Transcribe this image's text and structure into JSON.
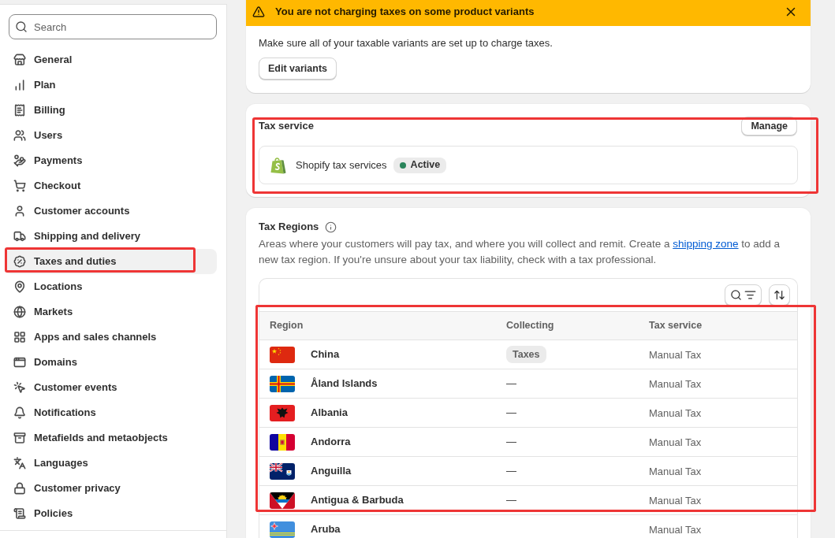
{
  "sidebar": {
    "search": {
      "placeholder": "Search"
    },
    "items": [
      {
        "label": "General",
        "selected": false,
        "highlighted": false
      },
      {
        "label": "Plan",
        "selected": false,
        "highlighted": false
      },
      {
        "label": "Billing",
        "selected": false,
        "highlighted": false
      },
      {
        "label": "Users",
        "selected": false,
        "highlighted": false
      },
      {
        "label": "Payments",
        "selected": false,
        "highlighted": false
      },
      {
        "label": "Checkout",
        "selected": false,
        "highlighted": false
      },
      {
        "label": "Customer accounts",
        "selected": false,
        "highlighted": false
      },
      {
        "label": "Shipping and delivery",
        "selected": false,
        "highlighted": false
      },
      {
        "label": "Taxes and duties",
        "selected": true,
        "highlighted": true
      },
      {
        "label": "Locations",
        "selected": false,
        "highlighted": false
      },
      {
        "label": "Markets",
        "selected": false,
        "highlighted": false
      },
      {
        "label": "Apps and sales channels",
        "selected": false,
        "highlighted": false
      },
      {
        "label": "Domains",
        "selected": false,
        "highlighted": false
      },
      {
        "label": "Customer events",
        "selected": false,
        "highlighted": false
      },
      {
        "label": "Notifications",
        "selected": false,
        "highlighted": false
      },
      {
        "label": "Metafields and metaobjects",
        "selected": false,
        "highlighted": false
      },
      {
        "label": "Languages",
        "selected": false,
        "highlighted": false
      },
      {
        "label": "Customer privacy",
        "selected": false,
        "highlighted": false
      },
      {
        "label": "Policies",
        "selected": false,
        "highlighted": false
      }
    ]
  },
  "banner": {
    "title": "You are not charging taxes on some product variants",
    "message": "Make sure all of your taxable variants are set up to charge taxes.",
    "button": "Edit variants"
  },
  "tax_service": {
    "title": "Tax service",
    "button": "Manage",
    "highlighted": true,
    "service": {
      "name": "Shopify tax services",
      "status": "Active"
    }
  },
  "tax_regions": {
    "title": "Tax Regions",
    "description_before": "Areas where your customers will pay tax, and where you will collect and remit. Create a ",
    "link": "shipping zone",
    "description_after": " to add a new tax region. If you're unsure about your tax liability, check with a tax professional.",
    "table": {
      "columns": [
        "Region",
        "Collecting",
        "Tax service"
      ],
      "header_highlighted": true,
      "rows": [
        {
          "region": "China",
          "collecting": {
            "kind": "tag",
            "text": "Taxes"
          },
          "tax_service": "Manual Tax",
          "highlighted": true
        },
        {
          "region": "Åland Islands",
          "collecting": {
            "kind": "plain",
            "text": "—"
          },
          "tax_service": "Manual Tax",
          "highlighted": true
        },
        {
          "region": "Albania",
          "collecting": {
            "kind": "plain",
            "text": "—"
          },
          "tax_service": "Manual Tax",
          "highlighted": true
        },
        {
          "region": "Andorra",
          "collecting": {
            "kind": "plain",
            "text": "—"
          },
          "tax_service": "Manual Tax",
          "highlighted": true
        },
        {
          "region": "Anguilla",
          "collecting": {
            "kind": "plain",
            "text": "—"
          },
          "tax_service": "Manual Tax",
          "highlighted": true
        },
        {
          "region": "Antigua & Barbuda",
          "collecting": {
            "kind": "plain",
            "text": "—"
          },
          "tax_service": "Manual Tax",
          "highlighted": true
        },
        {
          "region": "Aruba",
          "tax_service": "Manual Tax",
          "highlighted": false
        }
      ]
    }
  }
}
